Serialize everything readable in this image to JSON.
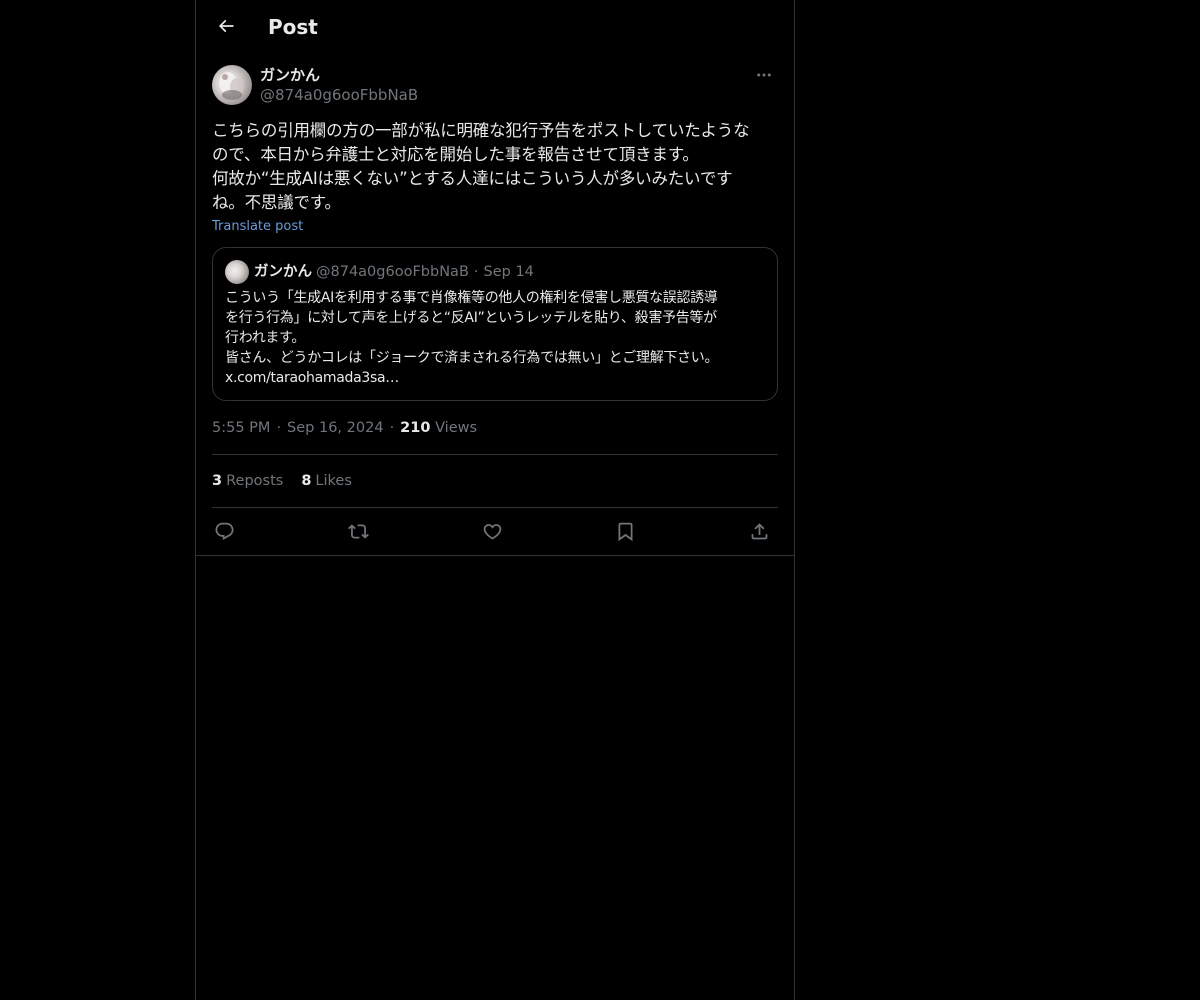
{
  "header": {
    "title": "Post",
    "back_icon": "arrow-left-icon"
  },
  "post": {
    "author": {
      "display_name": "ガンかん",
      "handle": "@874a0g6ooFbbNaB"
    },
    "more_icon": "more-horizontal-icon",
    "text": "こちらの引用欄の方の一部が私に明確な犯行予告をポストしていたような\nので、本日から弁護士と対応を開始した事を報告させて頂きます。\n何故か“生成AIは悪くない”とする人達にはこういう人が多いみたいです\nね。不思議です。",
    "translate_label": "Translate post",
    "quote": {
      "display_name": "ガンかん",
      "handle": "@874a0g6ooFbbNaB",
      "separator": "·",
      "date": "Sep 14",
      "text": "こういう「生成AIを利用する事で肖像権等の他人の権利を侵害し悪質な誤認誘導\nを行う行為」に対して声を上げると“反AI”というレッテルを貼り、殺害予告等が\n行われます。\n皆さん、どうかコレは「ジョークで済まされる行為では無い」とご理解下さい。\nx.com/taraohamada3sa…"
    },
    "time": "5:55 PM",
    "separator": "·",
    "date": "Sep 16, 2024",
    "views_count": "210",
    "views_label": "Views",
    "reposts_count": "3",
    "reposts_label": "Reposts",
    "likes_count": "8",
    "likes_label": "Likes",
    "actions": [
      "reply-icon",
      "repost-icon",
      "like-icon",
      "bookmark-icon",
      "share-icon"
    ]
  },
  "colors": {
    "background": "#000000",
    "text": "#e7e9ea",
    "secondary_text": "#71767b",
    "border": "#2f3336",
    "link": "#6a9bd8"
  }
}
